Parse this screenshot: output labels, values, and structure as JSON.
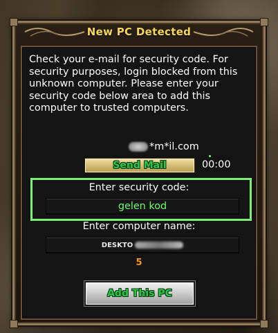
{
  "dialog": {
    "title": "New PC Detected",
    "message": "Check your e-mail for security code. For security purposes, login blocked from this unknown computer. Please enter your security code below area to add this computer to trusted computers.",
    "email_masked": "*m*il.com",
    "send_mail_label": "Send Mail",
    "timer": "00:00",
    "code_label": "Enter security code:",
    "code_value": "gelen kod",
    "pc_name_label": "Enter computer name:",
    "pc_name_value": "DESKTO",
    "char_count": "5",
    "add_pc_label": "Add This PC"
  },
  "colors": {
    "title": "#f5d65a",
    "button_text": "#2ec54b",
    "highlight_border": "#7cf07c",
    "code_text": "#6bff6b",
    "count": "#f29a1c"
  }
}
